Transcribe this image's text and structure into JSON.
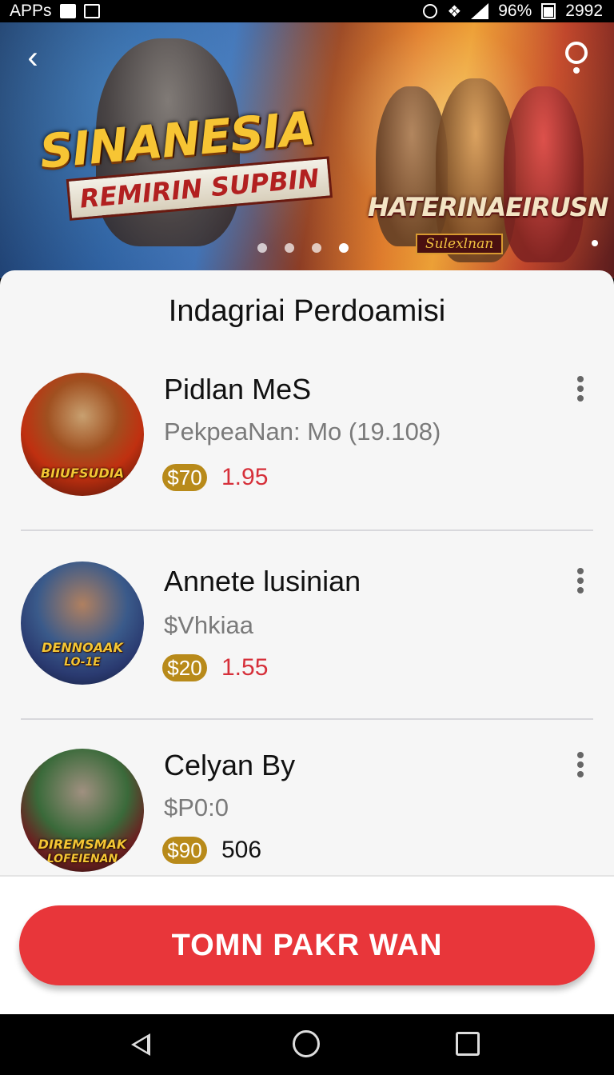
{
  "status_bar": {
    "left_text": "APPs",
    "right_text": "96%",
    "time": "2992",
    "icons": [
      "notification-icon",
      "image-icon",
      "alarm-icon",
      "vibrate-icon",
      "signal-icon",
      "battery-icon"
    ]
  },
  "hero": {
    "title": "SINANESIA",
    "subtitle": "REMIRIN SUPBIN",
    "title2": "HATERINAEIRUSN",
    "subtitle2": "Sulexlnan",
    "back_icon": "back-chevron-icon",
    "info_icon": "info-icon",
    "carousel_count": 4,
    "carousel_active": 3
  },
  "section": {
    "title": "Indagriai Perdoamisi"
  },
  "items": [
    {
      "name": "Pidlan MeS",
      "subtitle": "PekpeaNan: Mo (19.108)",
      "badge": "$70",
      "value": "1.95",
      "avatar_label": "BIIUFSUDIA",
      "avatar_sublabel": ""
    },
    {
      "name": "Annete lusinian",
      "subtitle": "$Vhkiaa",
      "badge": "$20",
      "value": "1.55",
      "avatar_label": "DENNOAAK",
      "avatar_sublabel": "LO-1E"
    },
    {
      "name": "Celyan By",
      "subtitle": "$P0:0",
      "badge": "$90",
      "value": "506",
      "avatar_label": "DIREMSMAK",
      "avatar_sublabel": "LOFEIENAN"
    }
  ],
  "cta": {
    "label": "TOMN PAKR WAN"
  },
  "nav": {
    "icons": [
      "nav-back-icon",
      "nav-home-icon",
      "nav-recent-icon"
    ]
  },
  "colors": {
    "accent": "#e8363a",
    "badge": "#b88a1a",
    "price_red": "#d6303a"
  }
}
